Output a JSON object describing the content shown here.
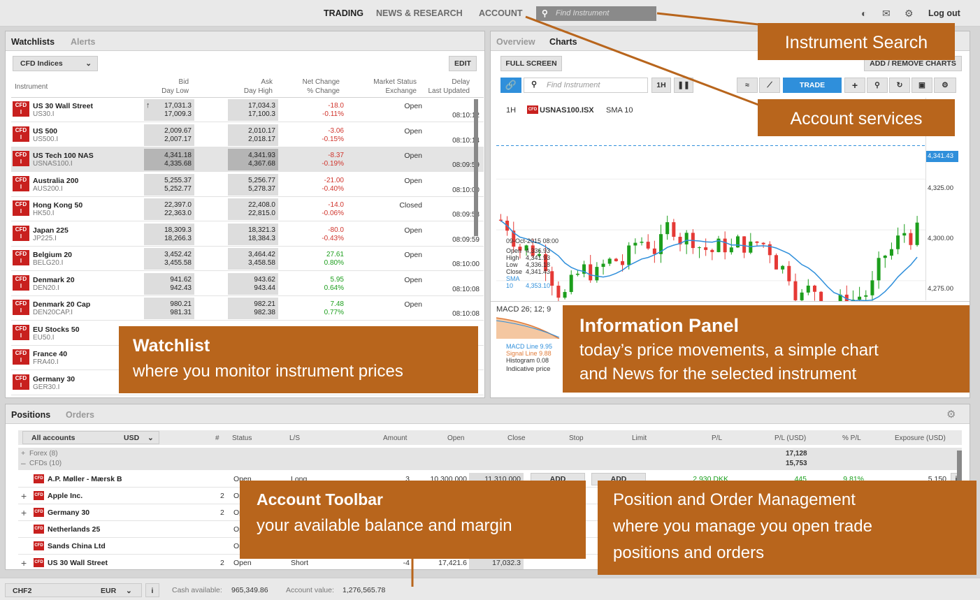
{
  "topnav": {
    "trading": "TRADING",
    "news": "NEWS & RESEARCH",
    "account": "ACCOUNT",
    "search_placeholder": "Find Instrument",
    "logout": "Log out"
  },
  "watchlist": {
    "tabs": [
      "Watchlists",
      "Alerts"
    ],
    "selector": "CFD Indices",
    "edit": "EDIT",
    "headers": {
      "instrument": "Instrument",
      "bid": "Bid",
      "day_low": "Day Low",
      "ask": "Ask",
      "day_high": "Day High",
      "net_change": "Net Change",
      "pct_change": "% Change",
      "market_status": "Market Status",
      "exchange": "Exchange",
      "delay": "Delay",
      "last_updated": "Last Updated"
    },
    "rows": [
      {
        "name": "US 30 Wall Street",
        "sym": "US30.I",
        "bid": "17,031.3",
        "low": "17,009.3",
        "ask": "17,034.3",
        "high": "17,100.3",
        "nc": "-18.0",
        "pc": "-0.11%",
        "status": "Open",
        "time": "08:10:12",
        "color": "red"
      },
      {
        "name": "US 500",
        "sym": "US500.I",
        "bid": "2,009.67",
        "low": "2,007.17",
        "ask": "2,010.17",
        "high": "2,018.17",
        "nc": "-3.06",
        "pc": "-0.15%",
        "status": "Open",
        "time": "08:10:14",
        "color": "red"
      },
      {
        "name": "US Tech 100 NAS",
        "sym": "USNAS100.I",
        "bid": "4,341.18",
        "low": "4,335.68",
        "ask": "4,341.93",
        "high": "4,367.68",
        "nc": "-8.37",
        "pc": "-0.19%",
        "status": "Open",
        "time": "08:09:59",
        "color": "red"
      },
      {
        "name": "Australia 200",
        "sym": "AUS200.I",
        "bid": "5,255.37",
        "low": "5,252.77",
        "ask": "5,256.77",
        "high": "5,278.37",
        "nc": "-21.00",
        "pc": "-0.40%",
        "status": "Open",
        "time": "08:10:00",
        "color": "red"
      },
      {
        "name": "Hong Kong 50",
        "sym": "HK50.I",
        "bid": "22,397.0",
        "low": "22,363.0",
        "ask": "22,408.0",
        "high": "22,815.0",
        "nc": "-14.0",
        "pc": "-0.06%",
        "status": "Closed",
        "time": "08:09:58",
        "color": "red"
      },
      {
        "name": "Japan 225",
        "sym": "JP225.I",
        "bid": "18,309.3",
        "low": "18,266.3",
        "ask": "18,321.3",
        "high": "18,384.3",
        "nc": "-80.0",
        "pc": "-0.43%",
        "status": "Open",
        "time": "08:09:59",
        "color": "red"
      },
      {
        "name": "Belgium 20",
        "sym": "BELG20.I",
        "bid": "3,452.42",
        "low": "3,455.58",
        "ask": "3,464.42",
        "high": "3,458.58",
        "nc": "27.61",
        "pc": "0.80%",
        "status": "Open",
        "time": "08:10:00",
        "color": "green"
      },
      {
        "name": "Denmark 20",
        "sym": "DEN20.I",
        "bid": "941.62",
        "low": "942.43",
        "ask": "943.62",
        "high": "943.44",
        "nc": "5.95",
        "pc": "0.64%",
        "status": "Open",
        "time": "08:10:08",
        "color": "green"
      },
      {
        "name": "Denmark 20 Cap",
        "sym": "DEN20CAP.I",
        "bid": "980.21",
        "low": "981.31",
        "ask": "982.21",
        "high": "982.38",
        "nc": "7.48",
        "pc": "0.77%",
        "status": "Open",
        "time": "08:10:08",
        "color": "green"
      },
      {
        "name": "EU Stocks 50",
        "sym": "EU50.I"
      },
      {
        "name": "France 40",
        "sym": "FRA40.I"
      },
      {
        "name": "Germany 30",
        "sym": "GER30.I"
      }
    ]
  },
  "chart_panel": {
    "tabs": [
      "Overview",
      "Charts"
    ],
    "full_screen": "FULL SCREEN",
    "add_remove": "ADD / REMOVE CHARTS",
    "search_placeholder": "Find Instrument",
    "tf": "1H",
    "trade": "TRADE",
    "title_tf": "1H",
    "title_sym": "USNAS100.ISX",
    "title_ind": "SMA 10",
    "price_axis": [
      "4,325.00",
      "4,300.00",
      "4,275.00"
    ],
    "current_price": "4,341.43",
    "ohlc": {
      "date": "09-Oct-2015 08:00",
      "rows": [
        [
          "Open",
          "4,336.93"
        ],
        [
          "High",
          "4,341.93"
        ],
        [
          "Low",
          "4,336.18"
        ],
        [
          "Close",
          "4,341.43"
        ],
        [
          "SMA 10",
          "4,353.10"
        ]
      ]
    },
    "macd_title": "MACD 26; 12; 9",
    "macd_legend": [
      [
        "MACD Line",
        "9.95"
      ],
      [
        "Signal Line",
        "9.88"
      ],
      [
        "Histogram",
        "0.08"
      ]
    ],
    "indicative": "Indicative price"
  },
  "annotations": {
    "search": "Instrument Search",
    "account": "Account services",
    "watchlist_t": "Watchlist",
    "watchlist_s": "where you monitor instrument prices",
    "info_t": "Information Panel",
    "info_s1": "today’s price movements, a simple chart",
    "info_s2": "and News for the selected instrument",
    "toolbar_t": "Account Toolbar",
    "toolbar_s": "your available balance and margin",
    "pos_1": "Position and Order Management",
    "pos_2": "where you manage you open trade",
    "pos_3": "positions and orders"
  },
  "positions": {
    "tabs": [
      "Positions",
      "Orders"
    ],
    "accounts": "All accounts",
    "currency": "USD",
    "headers": [
      "#",
      "Status",
      "L/S",
      "Amount",
      "Open",
      "Close",
      "Stop",
      "Limit",
      "P/L",
      "P/L (USD)",
      "% P/L",
      "Exposure (USD)"
    ],
    "groups": [
      {
        "name": "Forex (8)",
        "pl": "17,128"
      },
      {
        "name": "CFDs (10)",
        "pl": "15,753"
      }
    ],
    "rows": [
      {
        "name": "A.P. Møller - Mærsk B",
        "num": "",
        "status": "Open",
        "ls": "Long",
        "amount": "3",
        "open": "10,300.000",
        "close": "11,310.000",
        "stop": "ADD",
        "limit": "ADD",
        "pl": "2,930 DKK",
        "plusd": "445",
        "ppl": "9.81%",
        "exp": "5,150"
      },
      {
        "name": "Apple Inc.",
        "num": "2",
        "status": "Op"
      },
      {
        "name": "Germany 30",
        "num": "2",
        "status": "Op"
      },
      {
        "name": "Netherlands 25",
        "num": "",
        "status": "Op"
      },
      {
        "name": "Sands China Ltd",
        "num": "",
        "status": "Op"
      },
      {
        "name": "US 30 Wall Street",
        "num": "2",
        "status": "Open",
        "ls": "Short",
        "amount": "-4",
        "open": "17,421.6",
        "close": "17,032.3"
      }
    ]
  },
  "footer": {
    "account": "CHF2",
    "currency": "EUR",
    "cash_label": "Cash available:",
    "cash": "965,349.86",
    "value_label": "Account value:",
    "value": "1,276,565.78"
  },
  "chart_data": {
    "type": "candlestick",
    "title": "USNAS100.ISX",
    "timeframe": "1H",
    "ylim": [
      4265,
      4355
    ],
    "yticks": [
      4275,
      4300,
      4325
    ],
    "last": 4341.43,
    "indicator": "SMA 10"
  }
}
